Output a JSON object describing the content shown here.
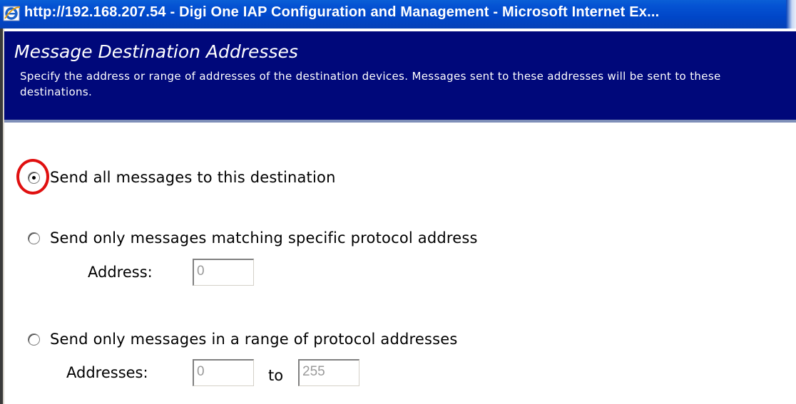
{
  "window": {
    "title": "http://192.168.207.54 - Digi One IAP Configuration and Management - Microsoft Internet Ex..."
  },
  "header": {
    "title": "Message Destination Addresses",
    "description": "Specify the address or range of addresses of the destination devices. Messages sent to these addresses will be sent to these destinations."
  },
  "options": [
    {
      "label": "Send all messages to this destination",
      "selected": true
    },
    {
      "label": "Send only messages matching specific protocol address",
      "selected": false
    },
    {
      "label": "Send only messages in a range of protocol addresses",
      "selected": false
    }
  ],
  "specific": {
    "address_label": "Address:",
    "address_value": "0"
  },
  "range": {
    "addresses_label": "Addresses:",
    "from_value": "0",
    "to_label": "to",
    "to_value": "255"
  },
  "colors": {
    "header_bg": "#00087a",
    "titlebar_bg": "#0046c8",
    "highlight": "#e01010"
  }
}
